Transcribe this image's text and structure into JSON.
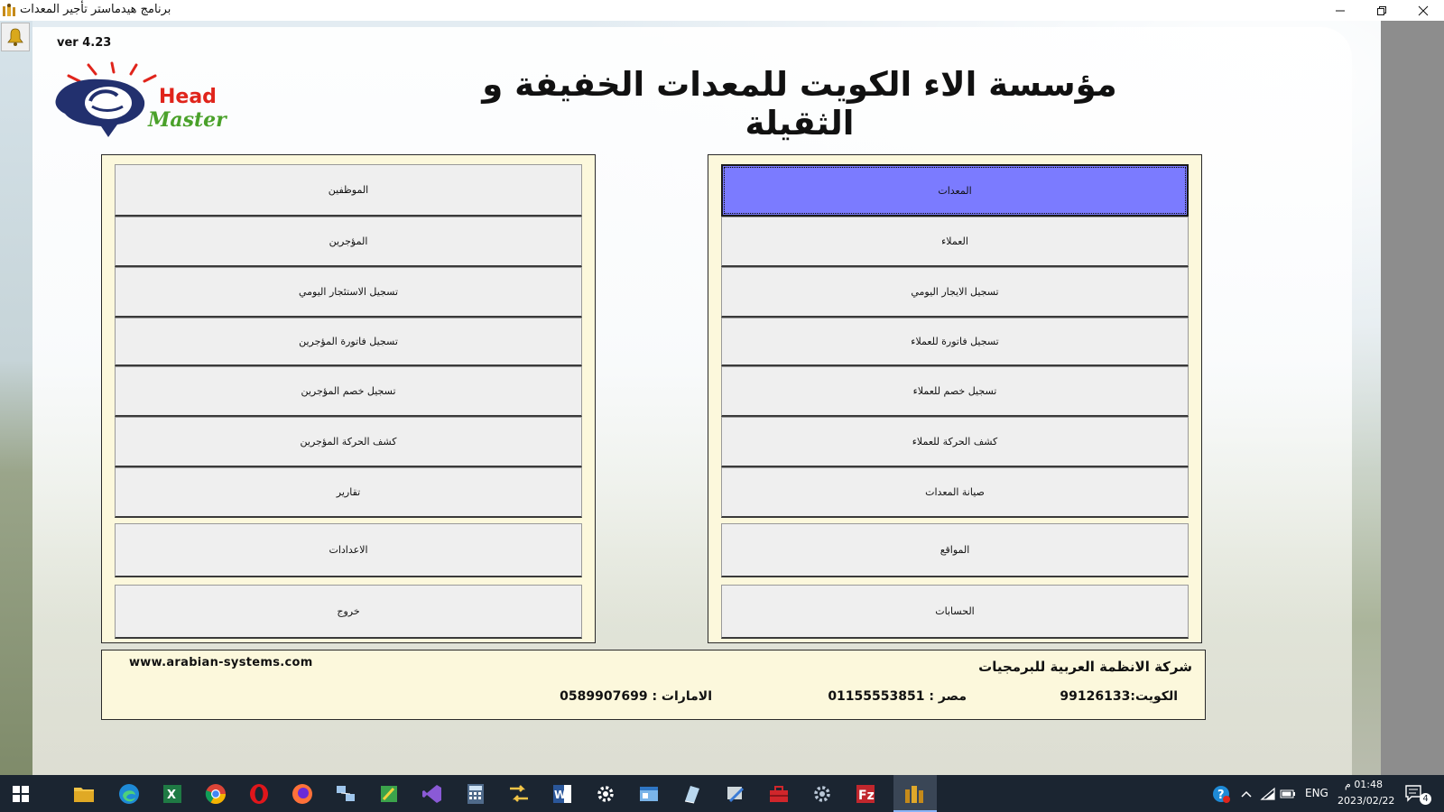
{
  "window": {
    "title": "برنامج هيدماستر تأجير المعدات"
  },
  "app": {
    "version": "ver 4.23",
    "logo_word1": "Head",
    "logo_word2": "Master",
    "company_title": "مؤسسة الاء الكويت للمعدات الخفيفة و الثقيلة"
  },
  "right_menu": {
    "items": [
      {
        "label": "المعدات",
        "active": true
      },
      {
        "label": "العملاء"
      },
      {
        "label": "تسجيل الايجار اليومي"
      },
      {
        "label": "تسجيل فاتورة للعملاء"
      },
      {
        "label": "تسجيل خصم للعملاء"
      },
      {
        "label": "كشف الحركة للعملاء"
      },
      {
        "label": "صيانة المعدات"
      },
      {
        "label": "المواقع"
      },
      {
        "label": "الحسابات"
      }
    ]
  },
  "left_menu": {
    "items": [
      {
        "label": "الموظفين"
      },
      {
        "label": "المؤجرين"
      },
      {
        "label": "تسجيل الاستئجار اليومي"
      },
      {
        "label": "تسجيل فاتورة المؤجرين"
      },
      {
        "label": "تسجيل خصم المؤجرين"
      },
      {
        "label": "كشف الحركة  المؤجرين"
      },
      {
        "label": "تقارير"
      },
      {
        "label": "الاعدادات"
      },
      {
        "label": "خروج"
      }
    ]
  },
  "footer": {
    "website": "www.arabian-systems.com",
    "company": "شركة الانظمة العربية للبرمجيات",
    "phones": {
      "kuwait": "الكويت:99126133",
      "egypt": "مصر : 01155553851",
      "uae": "الامارات : 0589907699"
    }
  },
  "taskbar": {
    "language": "ENG",
    "time": "01:48 م",
    "date": "2023/02/22",
    "notification_count": "4"
  },
  "colors": {
    "active_button": "#7b7bff",
    "panel_bg": "#fcf8dc",
    "taskbar_bg": "#1b2531"
  }
}
